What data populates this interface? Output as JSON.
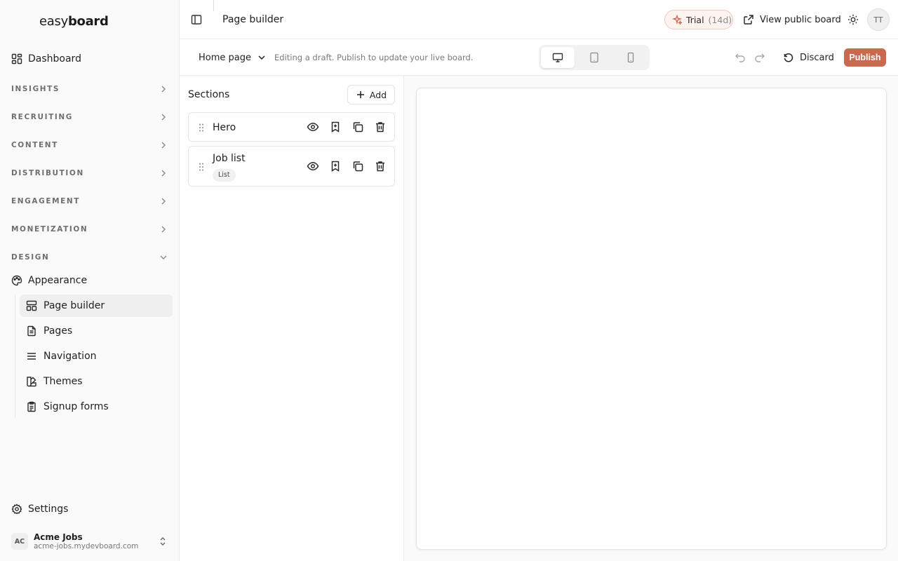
{
  "brand": {
    "logo_light": "easy",
    "logo_bold": "board"
  },
  "sidebar": {
    "dashboard": "Dashboard",
    "groups": [
      "INSIGHTS",
      "RECRUITING",
      "CONTENT",
      "DISTRIBUTION",
      "ENGAGEMENT",
      "MONETIZATION",
      "DESIGN"
    ],
    "appearance": "Appearance",
    "design_items": [
      "Page builder",
      "Pages",
      "Navigation",
      "Themes",
      "Signup forms"
    ],
    "settings": "Settings",
    "account": {
      "initials": "AC",
      "name": "Acme Jobs",
      "domain": "acme-jobs.mydevboard.com"
    }
  },
  "header": {
    "title": "Page builder",
    "trial_label": "Trial",
    "trial_days": "(14d)",
    "view_public": "View public board",
    "user_initials": "TT"
  },
  "toolbar": {
    "page_select": "Home page",
    "draft_note": "Editing a draft. Publish to update your live board.",
    "discard": "Discard",
    "publish": "Publish"
  },
  "panel": {
    "title": "Sections",
    "add": "Add",
    "sections": [
      {
        "name": "Hero"
      },
      {
        "name": "Job list",
        "badge": "List"
      }
    ]
  },
  "colors": {
    "accent": "#c9694d",
    "trial_bg": "#fdf3f0",
    "trial_border": "#f0c9bf"
  }
}
